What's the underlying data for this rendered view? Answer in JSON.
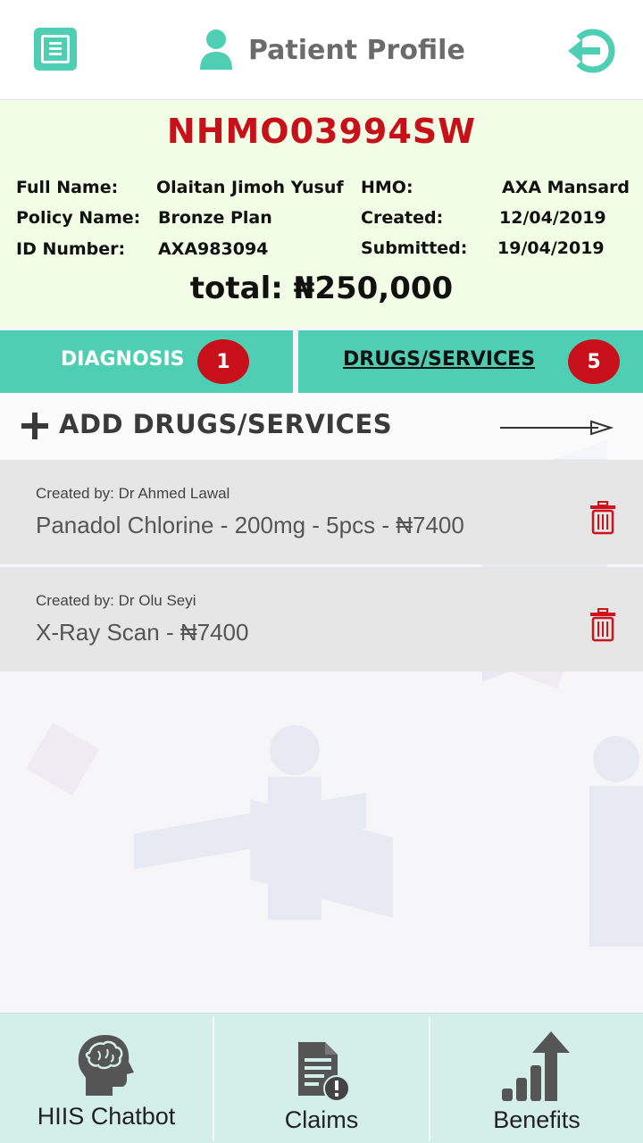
{
  "header": {
    "title": "Patient Profile",
    "menu_icon": "menu-icon",
    "profile_icon": "person-icon",
    "logout_icon": "logout-icon"
  },
  "patient": {
    "id": "NHMO03994SW",
    "full_name_label": "Full Name:",
    "full_name": "Olaitan Jimoh Yusuf",
    "policy_label": "Policy Name:",
    "policy": "Bronze Plan",
    "id_number_label": "ID Number:",
    "id_number": "AXA983094",
    "hmo_label": "HMO:",
    "hmo": "AXA Mansard",
    "created_label": "Created:",
    "created": "12/04/2019",
    "submitted_label": "Submitted:",
    "submitted": "19/04/2019",
    "total": "total: ₦250,000"
  },
  "tabs": [
    {
      "label": "DIAGNOSIS",
      "count": "1",
      "active": false
    },
    {
      "label": "DRUGS/SERVICES",
      "count": "5",
      "active": true
    }
  ],
  "add_row": {
    "label": "ADD DRUGS/SERVICES"
  },
  "items": [
    {
      "created_by": "Created by: Dr Ahmed Lawal",
      "text": "Panadol Chlorine - 200mg - 5pcs - ₦7400"
    },
    {
      "created_by": "Created by: Dr Olu Seyi",
      "text": "X-Ray Scan - ₦7400"
    }
  ],
  "bottom_nav": [
    {
      "label": "HIIS Chatbot",
      "icon": "brain-head-icon"
    },
    {
      "label": "Claims",
      "icon": "document-alert-icon"
    },
    {
      "label": "Benefits",
      "icon": "growth-chart-icon"
    }
  ],
  "colors": {
    "accent": "#4ecfb3",
    "danger": "#c8101a",
    "card_bg": "#f1fde5",
    "nav_bg": "#d3efe7"
  }
}
